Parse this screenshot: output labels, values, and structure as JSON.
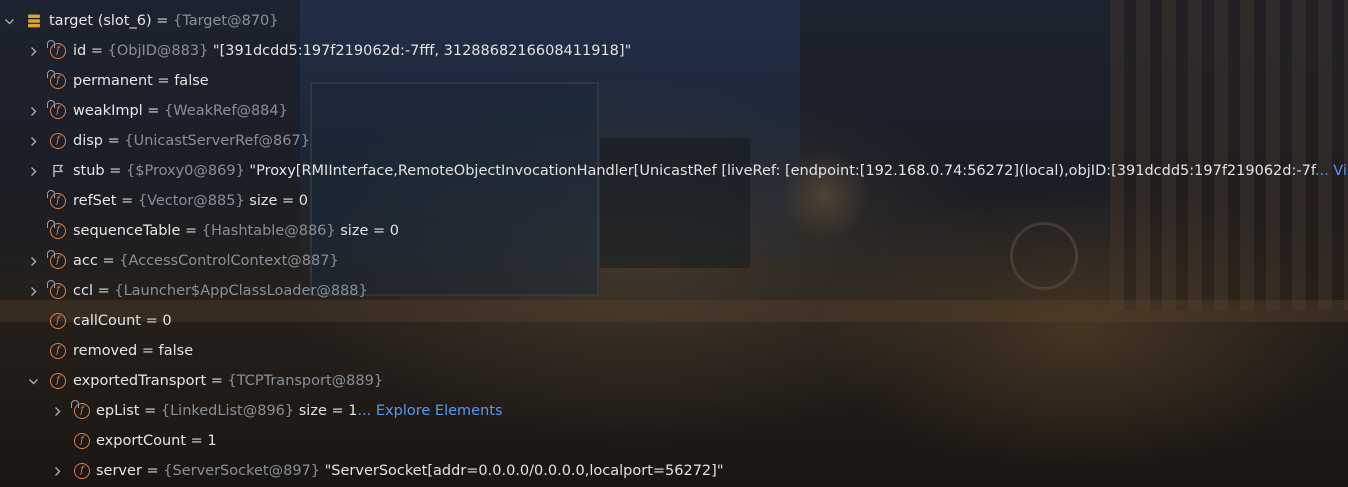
{
  "rows": [
    {
      "name": "target (slot_6)",
      "eq": " = ",
      "type": "{Target@870}",
      "value": "",
      "suffix": "",
      "link": ""
    },
    {
      "name": "id",
      "eq": " = ",
      "type": "{ObjID@883}",
      "value": " \"[391dcdd5:197f219062d:-7fff, 3128868216608411918]\"",
      "suffix": "",
      "link": ""
    },
    {
      "name": "permanent",
      "eq": " = ",
      "type": "",
      "value": "false",
      "suffix": "",
      "link": ""
    },
    {
      "name": "weakImpl",
      "eq": " = ",
      "type": "{WeakRef@884}",
      "value": "",
      "suffix": "",
      "link": ""
    },
    {
      "name": "disp",
      "eq": " = ",
      "type": "{UnicastServerRef@867}",
      "value": "",
      "suffix": "",
      "link": ""
    },
    {
      "name": "stub",
      "eq": " = ",
      "type": "{$Proxy0@869}",
      "value": " \"Proxy[RMIInterface,RemoteObjectInvocationHandler[UnicastRef [liveRef: [endpoint:[192.168.0.74:56272](local),objID:[391dcdd5:197f219062d:-7f",
      "suffix": "",
      "link": "... View"
    },
    {
      "name": "refSet",
      "eq": " = ",
      "type": "{Vector@885}",
      "value": "  size = 0",
      "suffix": "",
      "link": ""
    },
    {
      "name": "sequenceTable",
      "eq": " = ",
      "type": "{Hashtable@886}",
      "value": "  size = 0",
      "suffix": "",
      "link": ""
    },
    {
      "name": "acc",
      "eq": " = ",
      "type": "{AccessControlContext@887}",
      "value": "",
      "suffix": "",
      "link": ""
    },
    {
      "name": "ccl",
      "eq": " = ",
      "type": "{Launcher$AppClassLoader@888}",
      "value": "",
      "suffix": "",
      "link": ""
    },
    {
      "name": "callCount",
      "eq": " = ",
      "type": "",
      "value": "0",
      "suffix": "",
      "link": ""
    },
    {
      "name": "removed",
      "eq": " = ",
      "type": "",
      "value": "false",
      "suffix": "",
      "link": ""
    },
    {
      "name": "exportedTransport",
      "eq": " = ",
      "type": "{TCPTransport@889}",
      "value": "",
      "suffix": "",
      "link": ""
    },
    {
      "name": "epList",
      "eq": " = ",
      "type": "{LinkedList@896}",
      "value": "  size = 1",
      "suffix": "",
      "link": "... Explore Elements"
    },
    {
      "name": "exportCount",
      "eq": " = ",
      "type": "",
      "value": "1",
      "suffix": "",
      "link": ""
    },
    {
      "name": "server",
      "eq": " = ",
      "type": "{ServerSocket@897}",
      "value": " \"ServerSocket[addr=0.0.0.0/0.0.0.0,localport=56272]\"",
      "suffix": "",
      "link": ""
    }
  ],
  "icons": {
    "root": "database-icon",
    "field": "field-icon",
    "stub": "flag-icon",
    "expand": "chevron-right-icon",
    "collapse": "chevron-down-icon"
  },
  "colors": {
    "field_icon": "#d9804a",
    "type_text": "#8a8f97",
    "link_text": "#5896f0",
    "root_icon": "#d8a437"
  }
}
